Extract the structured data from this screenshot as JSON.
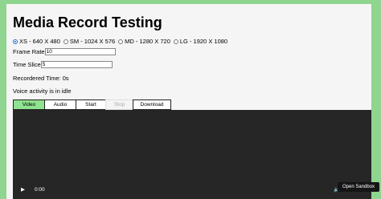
{
  "title": "Media Record Testing",
  "resolutions": [
    {
      "label": "XS - 640 X 480",
      "checked": true
    },
    {
      "label": "SM - 1024 X 576",
      "checked": false
    },
    {
      "label": "MD - 1280 X 720",
      "checked": false
    },
    {
      "label": "LG - 1920 X 1080",
      "checked": false
    }
  ],
  "frame_rate": {
    "label": "Frame Rate",
    "value": "10"
  },
  "time_slice": {
    "label": "Time Slice",
    "value": "5"
  },
  "recorded_time": "Recordered Time: 0s",
  "voice_activity": "Voice activity is in idle",
  "tabs": {
    "video": "Video",
    "audio": "Audio",
    "start": "Start",
    "stop": "Stop",
    "download": "Download"
  },
  "player": {
    "time": "0:00",
    "play_icon": "play-icon",
    "volume_icon": "volume-icon",
    "more_icon": "more-icon"
  },
  "sandbox_button": "Open Sandbox"
}
